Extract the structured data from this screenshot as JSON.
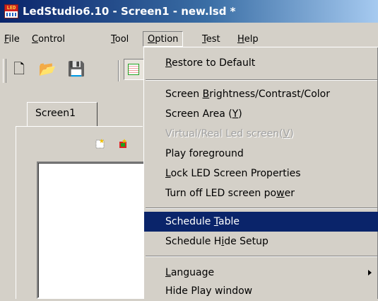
{
  "window": {
    "title": "LedStudio6.10 - Screen1 - new.lsd *",
    "app_icon_text": "LED",
    "icon": "app-icon"
  },
  "menubar": {
    "items": [
      {
        "label": "File",
        "accel": "F"
      },
      {
        "label": "Control",
        "accel": "C"
      },
      {
        "label": "Tool",
        "accel": "T"
      },
      {
        "label": "Option",
        "accel": "O",
        "open": true
      },
      {
        "label": "Test",
        "accel": "T"
      },
      {
        "label": "Help",
        "accel": "H"
      }
    ]
  },
  "toolbar": {
    "buttons": [
      {
        "icon": "new-file-icon",
        "glyph": "🗋"
      },
      {
        "icon": "open-folder-icon",
        "glyph": "📂"
      },
      {
        "icon": "save-icon",
        "glyph": "💾"
      }
    ]
  },
  "tabs": [
    {
      "label": "Screen1"
    }
  ],
  "option_menu": {
    "items": [
      {
        "label": "Restore to Default",
        "underline": "R"
      },
      {
        "separator": true
      },
      {
        "label": "Screen Brightness/Contrast/Color",
        "underline": "B"
      },
      {
        "label": "Screen Area (Y)",
        "underline": "Y"
      },
      {
        "label": "Virtual/Real Led screen(V)",
        "underline": "V",
        "disabled": true
      },
      {
        "label": "Play foreground"
      },
      {
        "label": "Lock LED Screen Properties",
        "underline": "L"
      },
      {
        "label": "Turn off LED screen power",
        "underline": "w"
      },
      {
        "separator": true
      },
      {
        "label": "Schedule Table",
        "underline": "T",
        "selected": true
      },
      {
        "label": "Schedule Hide Setup",
        "underline": "i"
      },
      {
        "separator": true
      },
      {
        "label": "Language",
        "underline": "L",
        "submenu": true
      },
      {
        "label": "Hide Play window"
      }
    ]
  },
  "colors": {
    "titlebar_start": "#0a246a",
    "titlebar_end": "#a6caf0",
    "menu_highlight": "#0a246a",
    "face": "#d4d0c8"
  }
}
